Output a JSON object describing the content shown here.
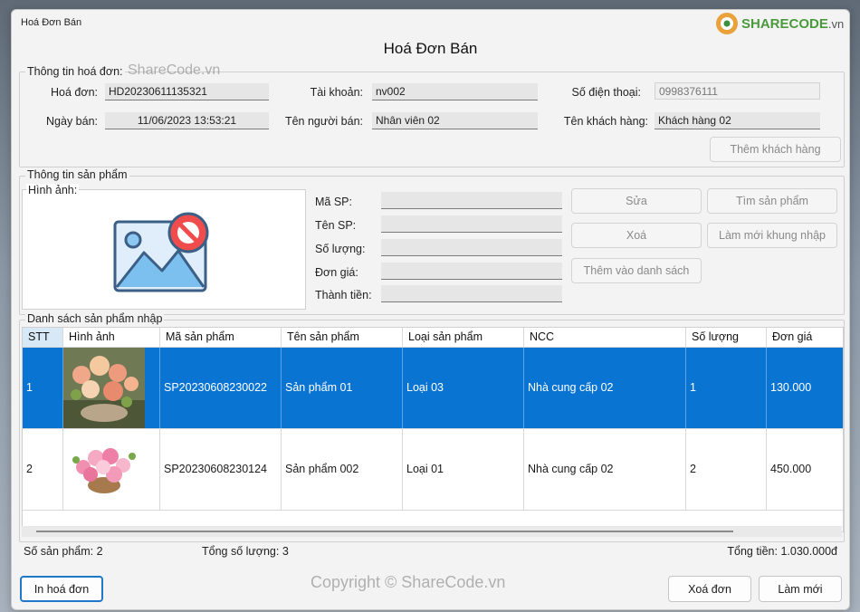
{
  "window": {
    "title": "Hoá Đơn Bán",
    "form_title": "Hoá Đơn Bán"
  },
  "branding": {
    "logo_text": "SHARECODE",
    "logo_suffix": ".vn",
    "watermark_top": "ShareCode.vn",
    "watermark_bottom": "Copyright © ShareCode.vn"
  },
  "invoice_info": {
    "legend": "Thông tin hoá đơn:",
    "invoice_label": "Hoá đơn:",
    "invoice_value": "HD20230611135321",
    "date_label": "Ngày bán:",
    "date_value": "11/06/2023 13:53:21",
    "account_label": "Tài khoản:",
    "account_value": "nv002",
    "seller_label": "Tên người bán:",
    "seller_value": "Nhân viên 02",
    "phone_label": "Số điện thoại:",
    "phone_value": "0998376111",
    "customer_label": "Tên khách hàng:",
    "customer_value": "Khách hàng 02",
    "add_customer_button": "Thêm khách hàng"
  },
  "product_info": {
    "legend": "Thông tin sản phẩm",
    "image_legend": "Hình ảnh:",
    "code_label": "Mã SP:",
    "name_label": "Tên SP:",
    "qty_label": "Số lượng:",
    "price_label": "Đơn giá:",
    "total_label": "Thành tiền:",
    "code_value": "",
    "name_value": "",
    "qty_value": "",
    "price_value": "",
    "total_value": "",
    "edit_button": "Sửa",
    "find_button": "Tìm sản phẩm",
    "delete_button": "Xoá",
    "refresh_form_button": "Làm mới khung nhập",
    "add_to_list_button": "Thêm vào danh sách"
  },
  "product_list": {
    "legend": "Danh sách sản phẩm nhập",
    "columns": [
      "STT",
      "Hình ảnh",
      "Mã sản phẩm",
      "Tên sản phẩm",
      "Loại sản phẩm",
      "NCC",
      "Số lượng",
      "Đơn giá"
    ],
    "rows": [
      {
        "stt": "1",
        "code": "SP20230608230022",
        "name": "Sản phẩm 01",
        "type": "Loại 03",
        "supplier": "Nhà cung cấp 02",
        "qty": "1",
        "price": "130.000",
        "image": "flower-basket-photo"
      },
      {
        "stt": "2",
        "code": "SP20230608230124",
        "name": "Sản phẩm 002",
        "type": "Loại 01",
        "supplier": "Nhà cung cấp 02",
        "qty": "2",
        "price": "450.000",
        "image": "pink-bouquet-photo"
      }
    ]
  },
  "summary": {
    "product_count": "Số sản phẩm: 2",
    "total_qty": "Tổng số lượng: 3",
    "total_amount": "Tổng tiền: 1.030.000đ"
  },
  "actions": {
    "print_button": "In hoá đơn",
    "delete_invoice_button": "Xoá đơn",
    "refresh_button": "Làm mới"
  },
  "colors": {
    "selection": "#0a74d3",
    "accent": "#1e78c8"
  }
}
